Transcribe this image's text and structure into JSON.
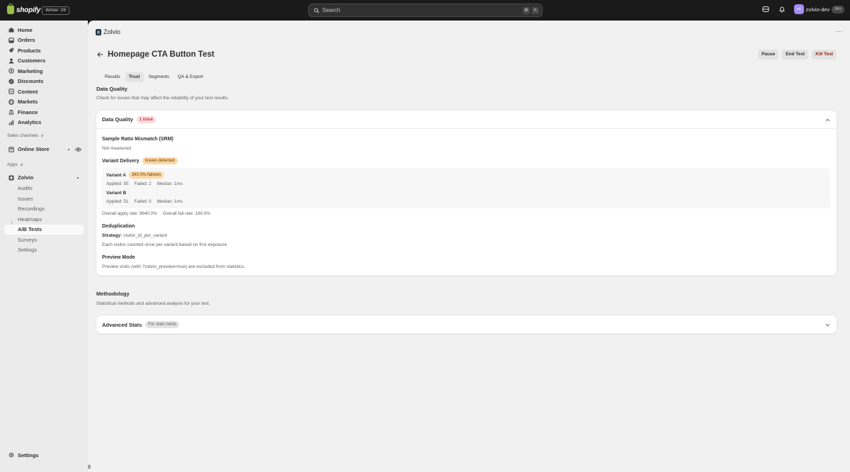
{
  "topbar": {
    "brand": "shopify",
    "edition": "Winter '26",
    "search_placeholder": "Search",
    "shortcut_keys": [
      "⌘",
      "K"
    ],
    "account_initials": "zd",
    "account_name": "zolvio-dev",
    "account_badge": "dev"
  },
  "sidebar": {
    "items": [
      {
        "label": "Home",
        "icon": "home-icon"
      },
      {
        "label": "Orders",
        "icon": "orders-icon"
      },
      {
        "label": "Products",
        "icon": "tag-icon"
      },
      {
        "label": "Customers",
        "icon": "person-icon"
      },
      {
        "label": "Marketing",
        "icon": "target-icon"
      },
      {
        "label": "Discounts",
        "icon": "discount-icon"
      },
      {
        "label": "Content",
        "icon": "content-icon"
      },
      {
        "label": "Markets",
        "icon": "globe-icon"
      },
      {
        "label": "Finance",
        "icon": "bank-icon"
      },
      {
        "label": "Analytics",
        "icon": "chart-icon"
      }
    ],
    "sales_channels_label": "Sales channels",
    "online_store": "Online Store",
    "apps_label": "Apps",
    "app_name": "Zolvio",
    "app_items": [
      "Audits",
      "Issues",
      "Recordings",
      "Heatmaps",
      "A/B Tests",
      "Surveys",
      "Settings"
    ],
    "active_app_item": "A/B Tests",
    "settings": "Settings"
  },
  "main": {
    "app_title": "Zolvio",
    "page_title": "Homepage CTA Button Test",
    "actions": {
      "pause": "Pause",
      "end": "End Test",
      "kill": "Kill Test"
    },
    "tabs": [
      "Results",
      "Trust",
      "Segments",
      "QA & Export"
    ],
    "active_tab": "Trust",
    "data_quality": {
      "title": "Data Quality",
      "description": "Check for issues that may affect the reliability of your test results.",
      "card_title": "Data Quality",
      "issue_badge": "1 issue",
      "srm_title": "Sample Ratio Mismatch (SRM)",
      "srm_value": "Not measured",
      "variant_delivery_title": "Variant Delivery",
      "variant_delivery_badge": "Issues detected",
      "variants": [
        {
          "name": "Variant A",
          "badge": "340.0% failures",
          "applied": "Applied: 55",
          "failed": "Failed: 2",
          "median": "Median: 1ms"
        },
        {
          "name": "Variant B",
          "applied": "Applied: 51",
          "failed": "Failed: 0",
          "median": "Median: 1ms"
        }
      ],
      "overall_apply": "Overall apply rate: 9640.0%",
      "overall_fail": "Overall fail rate: 180.0%",
      "dedup_title": "Deduplication",
      "dedup_strategy_label": "Strategy:",
      "dedup_strategy_value": "visitor_id_per_variant",
      "dedup_desc": "Each visitor counted once per variant based on first exposure",
      "preview_title": "Preview Mode",
      "preview_desc": "Preview visits (with ?zolvio_preview=true) are excluded from statistics."
    },
    "methodology": {
      "title": "Methodology",
      "description": "Statistical methods and advanced analysis for your test.",
      "card_title": "Advanced Stats",
      "badge": "For stats nerds"
    }
  },
  "footer_symbol": "$",
  "colors": {
    "accent_avatar": "#a48bf5",
    "critical_badge": "#fedad9",
    "warning_badge": "#ffd6a4",
    "danger_text": "#8e1f0b"
  }
}
